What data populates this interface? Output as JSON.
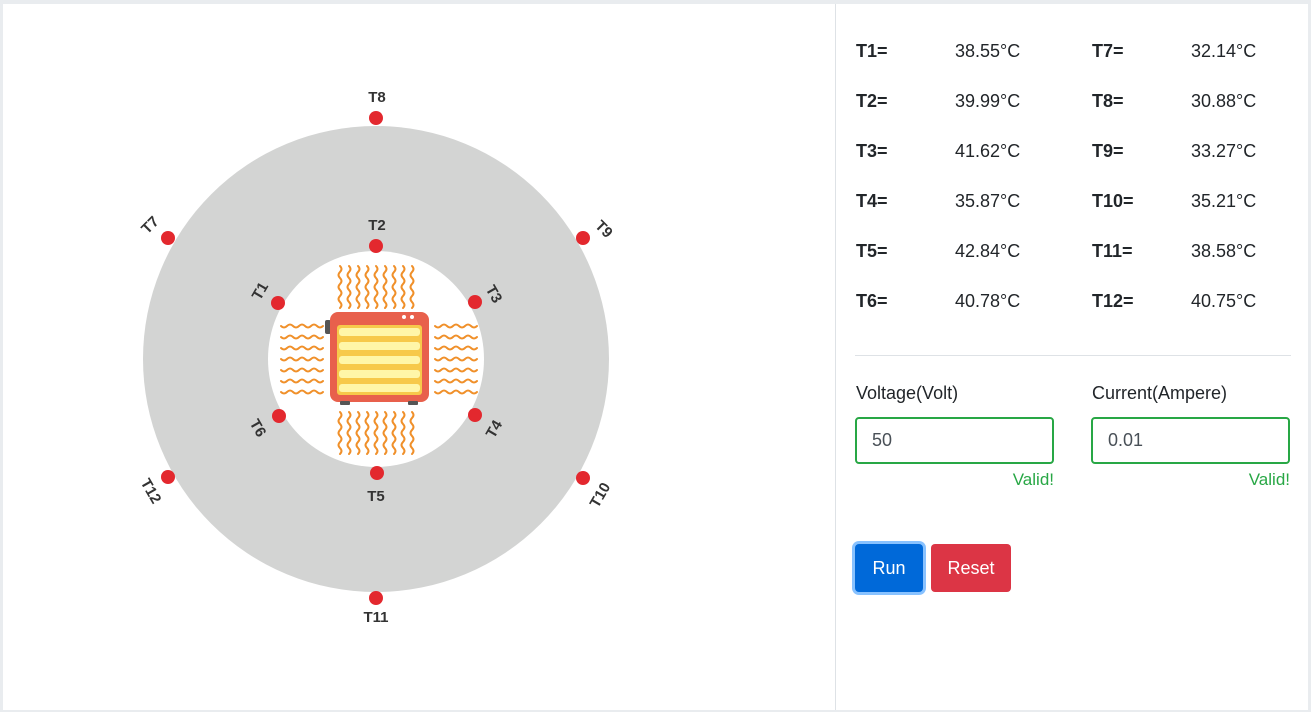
{
  "readings": {
    "left": [
      {
        "label": "T1=",
        "value": "38.55°C"
      },
      {
        "label": "T2=",
        "value": "39.99°C"
      },
      {
        "label": "T3=",
        "value": "41.62°C"
      },
      {
        "label": "T4=",
        "value": "35.87°C"
      },
      {
        "label": "T5=",
        "value": "42.84°C"
      },
      {
        "label": "T6=",
        "value": "40.78°C"
      }
    ],
    "right": [
      {
        "label": "T7=",
        "value": "32.14°C"
      },
      {
        "label": "T8=",
        "value": "30.88°C"
      },
      {
        "label": "T9=",
        "value": "33.27°C"
      },
      {
        "label": "T10=",
        "value": "35.21°C"
      },
      {
        "label": "T11=",
        "value": "38.58°C"
      },
      {
        "label": "T12=",
        "value": "40.75°C"
      }
    ]
  },
  "form": {
    "voltage_label": "Voltage(Volt)",
    "voltage_value": "50",
    "current_label": "Current(Ampere)",
    "current_value": "0.01",
    "valid_text": "Valid!"
  },
  "buttons": {
    "run_label": "Run",
    "reset_label": "Reset"
  },
  "diagram": {
    "sensors": [
      "T1",
      "T2",
      "T3",
      "T4",
      "T5",
      "T6",
      "T7",
      "T8",
      "T9",
      "T10",
      "T11",
      "T12"
    ],
    "ring_color": "#d3d4d3",
    "sensor_color": "#e3282e",
    "heater_icon": "heater-icon",
    "heat_wave_color": "#f0902a"
  }
}
